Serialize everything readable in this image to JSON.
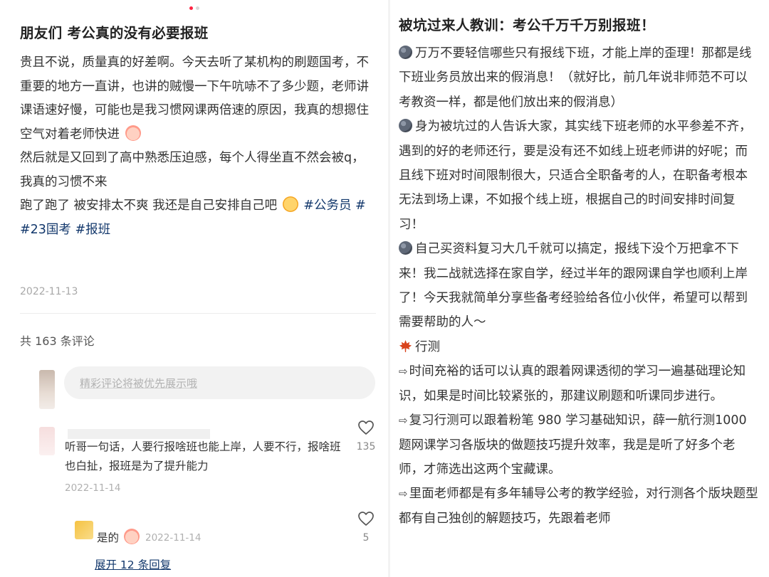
{
  "left": {
    "post": {
      "title": "朋友们 考公真的没有必要报班",
      "p1": "贵且不说，质量真的好差啊。今天去听了某机构的刷题国考，不重要的地方一直讲，也讲的贼慢一下午吭哧不了多少题，老师讲课语速好慢，可能也是我习惯网课两倍速的原因，我真的想摁住空气对着老师快进",
      "p2": "然后就是又回到了高中熟悉压迫感，每个人得坐直不然会被q，我真的习惯不来",
      "p3": "跑了跑了 被安排太不爽 我还是自己安排自己吧",
      "tags": [
        "#公务员",
        "#",
        "#23国考",
        "#报班"
      ],
      "date": "2022-11-13"
    },
    "comments_count_label": "共 163 条评论",
    "comment_input_placeholder": "精彩评论将被优先展示哦",
    "comments": [
      {
        "text": "听哥一句话，人要行报啥班也能上岸，人要不行，报啥班也白扯，报班是为了提升能力",
        "date": "2022-11-14",
        "likes": "135"
      }
    ],
    "reply": {
      "text": "是的",
      "date": "2022-11-14",
      "likes": "5"
    },
    "expand_label": "展开 12 条回复"
  },
  "right": {
    "title": "被坑过来人教训：考公千万千万别报班！",
    "p1": "万万不要轻信哪些只有报线下班，才能上岸的歪理！那都是线下班业务员放出来的假消息！（就好比，前几年说非师范不可以考教资一样，都是他们放出来的假消息）",
    "p2": "身为被坑过的人告诉大家，其实线下班老师的水平参差不齐，遇到的好的老师还行，要是没有还不如线上班老师讲的好呢；而且线下班对时间限制很大，只适合全职备考的人，在职备考根本无法到场上课，不如报个线上班，根据自己的时间安排时间复习！",
    "p3": "自己买资料复习大几千就可以搞定，报线下没个万把拿不下来！我二战就选择在家自学，经过半年的跟网课自学也顺利上岸了！今天我就简单分享些备考经验给各位小伙伴，希望可以帮到需要帮助的人～",
    "section": "行测",
    "b1": "时间充裕的话可以认真的跟着网课透彻的学习一遍基础理论知识，如果是时间比较紧张的，那建议刷题和听课同步进行。",
    "b2": "复习行测可以跟着粉笔 980 学习基础知识，薛一航行测1000题网课学习各版块的做题技巧提升效率，我是是听了好多个老师，才筛选出这两个宝藏课。",
    "b3": "里面老师都是有多年辅导公考的教学经验，对行测各个版块题型都有自己独创的解题技巧，先跟着老师"
  },
  "colors": {
    "accent": "#ff2442",
    "tag": "#13386c",
    "date": "#a8a8a8"
  },
  "icons": {
    "heart": "heart-icon",
    "moon": "moon-emoji-icon",
    "maple": "maple-leaf-icon",
    "arrow": "arrow-right-icon"
  }
}
